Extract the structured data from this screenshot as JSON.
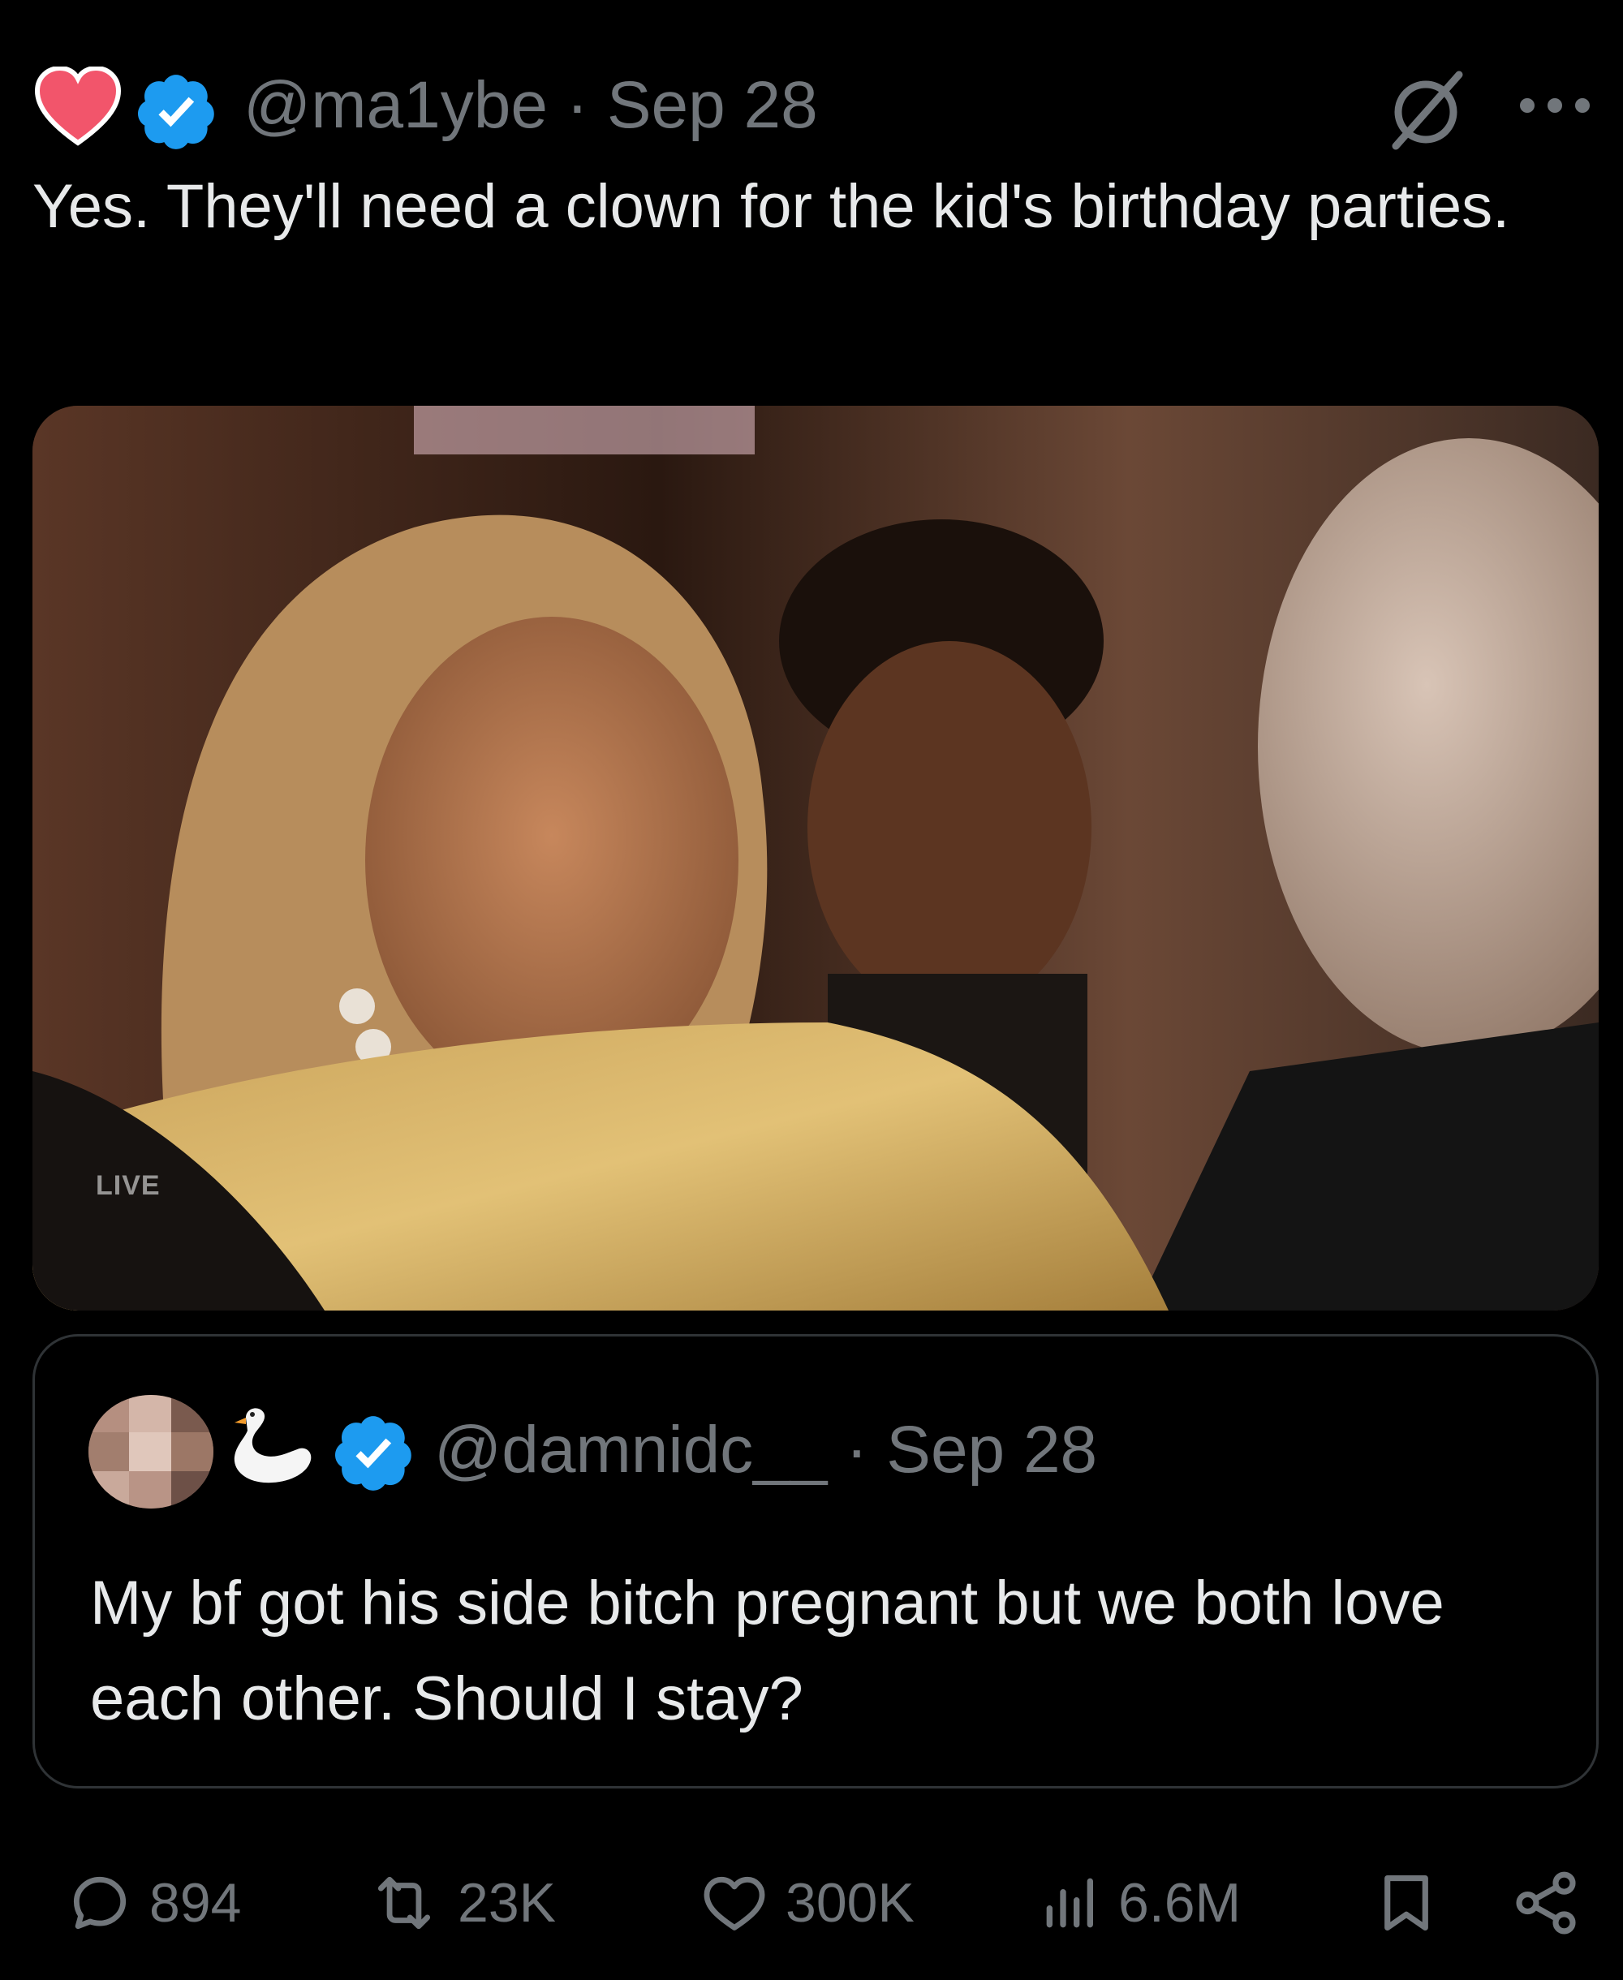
{
  "tweet": {
    "handle": "@ma1ybe",
    "separator": "·",
    "date": "Sep 28",
    "handle_line": "@ma1ybe · Sep 28",
    "text": "Yes. They'll need a clown for the kid's birthday parties.",
    "media": {
      "overlay_label": "LIVE"
    }
  },
  "quoted_tweet": {
    "handle_line": "@damnidc__ · Sep 28",
    "text": "My bf got his side bitch pregnant but we both love each other. Should I stay?"
  },
  "actions": {
    "replies": "894",
    "reposts": "23K",
    "likes": "300K",
    "views": "6.6M"
  },
  "colors": {
    "background": "#000000",
    "text_primary": "#e7e9ea",
    "text_secondary": "#71767b",
    "verified_blue": "#1d9bf0",
    "heart_red": "#f2556b",
    "border": "#2f3336"
  },
  "icons": [
    "heart-badge-icon",
    "verified-badge-icon",
    "null-sign-icon",
    "more-icon",
    "swan-icon",
    "reply-icon",
    "repost-icon",
    "like-icon",
    "views-icon",
    "bookmark-icon",
    "share-icon"
  ]
}
